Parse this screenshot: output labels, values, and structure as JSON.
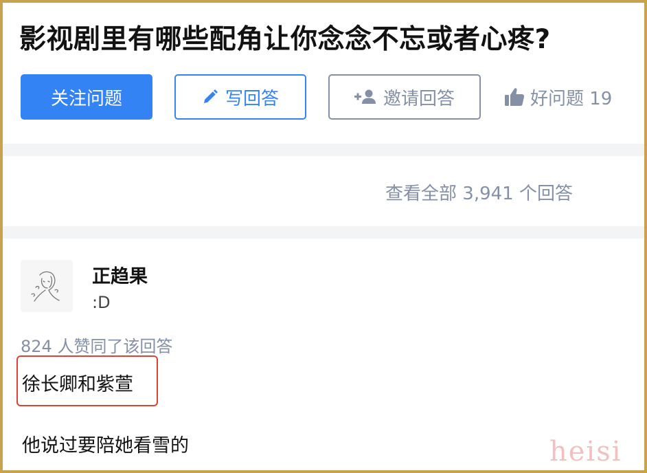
{
  "question": {
    "title": "影视剧里有哪些配角让你念念不忘或者心疼?"
  },
  "actions": {
    "follow_label": "关注问题",
    "write_label": "写回答",
    "invite_label": "邀请回答",
    "good_question_label": "好问题 19"
  },
  "answers_summary": {
    "view_all_label": "查看全部 3,941 个回答"
  },
  "answer": {
    "author_name": "正趋果",
    "author_bio": ":D",
    "vote_text": "824 人赞同了该回答",
    "lines": [
      "徐长卿和紫萱",
      "他说过要陪她看雪的"
    ]
  },
  "watermark": "heisi",
  "colors": {
    "accent": "#3483f5",
    "muted": "#8590a6",
    "highlight_border": "#d94334",
    "frame_border": "#c8a24e"
  },
  "icons": {
    "write": "pencil-icon",
    "invite": "add-person-icon",
    "good_question": "thumbs-up-icon",
    "avatar": "sketch-avatar"
  }
}
